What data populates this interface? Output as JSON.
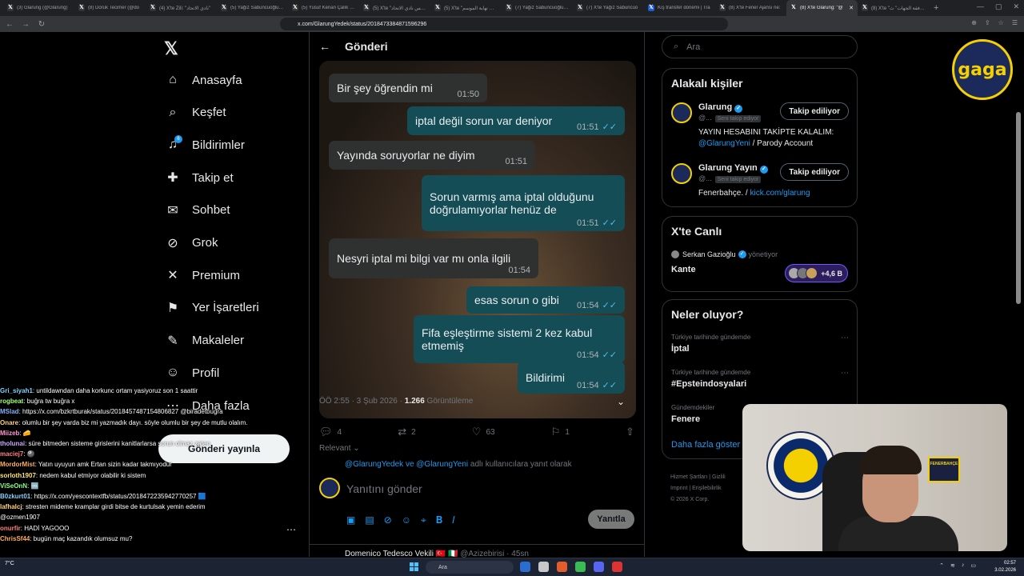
{
  "browser": {
    "tabs": [
      {
        "label": "(3) Glarung (@Glarung)",
        "color": "#333"
      },
      {
        "label": "(8) Doruk Tecimer (@do",
        "color": "#333"
      },
      {
        "label": "(4) X'te Ziİi: \"نادي الاتحاد\"",
        "color": "#333"
      },
      {
        "label": "(5) Yağız Sabuncuoğlu (@",
        "color": "#333"
      },
      {
        "label": "(5) Yusuf Kenan Çalık (@",
        "color": "#333"
      },
      {
        "label": "(5) X'te \"رئيس نادي الاتحاد\"",
        "color": "#333"
      },
      {
        "label": "(5) X'te \"نادي نهاية الموسم\"",
        "color": "#333"
      },
      {
        "label": "(7) Yağız Sabuncuoğlu (@",
        "color": "#333"
      },
      {
        "label": "(7) X'te Yağız Sabuncuo",
        "color": "#333"
      },
      {
        "label": "Kış transfer dönemi | Tra",
        "color": "#1a5ad7"
      },
      {
        "label": "(8) X'te Fener Ajansı ne: ",
        "color": "#333"
      },
      {
        "label": "(8) X'te Glarung: \"@",
        "color": "#333"
      },
      {
        "label": "(8) X'te \"موافقة الجهات\" ث",
        "color": "#333"
      }
    ],
    "active_tab": 11,
    "new_tab": "+",
    "url": "x.com/GlarungYedek/status/2018473384871596296"
  },
  "nav": {
    "items": [
      {
        "label": "Anasayfa",
        "icon": "⌂",
        "name": "home"
      },
      {
        "label": "Keşfet",
        "icon": "⌕",
        "name": "explore"
      },
      {
        "label": "Bildirimler",
        "icon": "♫",
        "name": "notifications",
        "badge": "6"
      },
      {
        "label": "Takip et",
        "icon": "✚",
        "name": "follow"
      },
      {
        "label": "Sohbet",
        "icon": "✉",
        "name": "chat"
      },
      {
        "label": "Grok",
        "icon": "⊘",
        "name": "grok"
      },
      {
        "label": "Premium",
        "icon": "✕",
        "name": "premium"
      },
      {
        "label": "Yer İşaretleri",
        "icon": "⚑",
        "name": "bookmarks"
      },
      {
        "label": "Makaleler",
        "icon": "✎",
        "name": "articles"
      },
      {
        "label": "Profil",
        "icon": "☺",
        "name": "profile"
      },
      {
        "label": "Daha fazla",
        "icon": "⋯",
        "name": "more"
      }
    ],
    "post_button": "Gönderi yayınla"
  },
  "chat": [
    {
      "user": "Gri_siyah1",
      "color": "#7fd3ff",
      "text": ": untildawndan daha korkunc ortam yasiyoruz son 1 saattir"
    },
    {
      "user": "rogbeat",
      "color": "#a0ff7a",
      "text": ": buğra tw buğra x"
    },
    {
      "user": "MSlad",
      "color": "#7fb3ff",
      "text": ": https://x.com/bzkrtburak/status/2018457487154806827 @biradetbugra"
    },
    {
      "user": "Onare",
      "color": "#ffd27f",
      "text": ": olumlu bir şey varda biz mi yazmadık dayı. söyle olumlu bir şey de mutlu olalım."
    },
    {
      "user": "Miizeb",
      "color": "#ff9ad5",
      "text": ": 🧀"
    },
    {
      "user": "tholunai",
      "color": "#c7a8ff",
      "text": ": süre bitmeden sisteme girislerini kanitlarlarsa sorun olmaz zaten"
    },
    {
      "user": "maciej7",
      "color": "#ff7f7f",
      "text": ": 🎱"
    },
    {
      "user": "MordorMist",
      "color": "#ffae5c",
      "text": ": Yatın uyuyun amk Ertan sizin kadar takmıyodur"
    },
    {
      "user": "sorloth1907",
      "color": "#ffe36b",
      "text": ": nedem kabul etmiyor olabilir ki sistem"
    },
    {
      "user": "ViSeOnN",
      "color": "#8aff8a",
      "text": ": 🆒"
    },
    {
      "user": "B0zkurt01",
      "color": "#7fd3ff",
      "text": ": https://x.com/yescontextfb/status/2018472235942770257 🟦"
    },
    {
      "user": "lafhalcj",
      "color": "#ffd27f",
      "text": ": stresten mideme kramplar girdi bitse de kurtulsak yemin ederim"
    },
    {
      "user": "",
      "color": "#fff",
      "text": "@ozmen1907"
    },
    {
      "user": "onurfir",
      "color": "#ff7f7f",
      "text": ": HADİ YAGOOO"
    },
    {
      "user": "ChrisSf44",
      "color": "#ffae5c",
      "text": ": bugün maç kazandık olumsuz mu?"
    }
  ],
  "post": {
    "header_title": "Gönderi",
    "messages": [
      {
        "dir": "in",
        "text": "Bir şey öğrendin mi",
        "time": "01:50",
        "read": ""
      },
      {
        "dir": "out",
        "text": "iptal değil sorun var deniyor",
        "time": "01:51",
        "read": "✓✓"
      },
      {
        "dir": "in",
        "text": "Yayında soruyorlar ne diyim",
        "time": "01:51",
        "read": ""
      },
      {
        "dir": "out",
        "text": "Sorun varmış ama iptal olduğunu doğrulamıyorlar henüz de",
        "time": "01:51",
        "read": "✓✓"
      },
      {
        "dir": "in",
        "text": "Nesyri iptal mi bilgi var mı onla ilgili",
        "time": "01:54",
        "read": ""
      },
      {
        "dir": "out",
        "text": "esas sorun o gibi",
        "time": "01:54",
        "read": "✓✓"
      },
      {
        "dir": "out",
        "text": "Fifa eşleştirme sistemi 2 kez kabul etmemiş",
        "time": "01:54",
        "read": "✓✓"
      },
      {
        "dir": "out",
        "text": "Bildirimi",
        "time": "01:54",
        "read": "✓✓"
      }
    ],
    "timestamp": "ÖÖ 2:55 · 3 Şub 2026 · ",
    "views": "1.266",
    "views_label": " Görüntüleme",
    "replies": "4",
    "reposts": "2",
    "likes": "63",
    "bookmarks": "1",
    "sort_label": "Relevant",
    "reply_to_mentions": "@GlarungYedek ve @GlarungYeni",
    "reply_to_suffix": " adlı kullanıcılara yanıt olarak",
    "compose_placeholder": "Yanıtını gönder",
    "reply_button": "Yanıtla",
    "next_author": "Domenico Tedesco Vekili 🇹🇷 🇮🇹",
    "next_handle": " @Azizebirisi · 45sn"
  },
  "right": {
    "search_placeholder": "Ara",
    "related_title": "Alakalı kişiler",
    "people": [
      {
        "name": "Glarung",
        "handle": "@...",
        "follows_you": "Seni takip ediyor",
        "button": "Takip ediliyor",
        "bio_pre": "YAYIN HESABINI TAKİPTE KALALIM: ",
        "bio_link": "@GlarungYeni",
        "bio_post": " / Parody Account"
      },
      {
        "name": "Glarung Yayın",
        "handle": "@...",
        "follows_you": "Seni takip ediyor",
        "button": "Takip ediliyor",
        "bio_pre": "Fenerbahçe. / ",
        "bio_link": "kick.com/glarung",
        "bio_post": ""
      }
    ],
    "live_title": "X'te Canlı",
    "live_host": "Serkan Gazioğlu",
    "live_role": "yönetiyor",
    "live_space": "Kante",
    "live_count": "+4,6 B",
    "trends_title": "Neler oluyor?",
    "trends": [
      {
        "context": "Türkiye tarihinde gündemde",
        "topic": "İptal"
      },
      {
        "context": "Türkiye tarihinde gündemde",
        "topic": "#Epsteindosyalari"
      },
      {
        "context": "Gündemdekiler",
        "topic": "Fenere"
      }
    ],
    "show_more": "Daha fazla göster",
    "footer": [
      "Hizmet Şartları",
      "Gizlili",
      "Imprint",
      "Erişilebilirlik",
      "© 2026 X Corp."
    ]
  },
  "overlay": {
    "logo_text": "gaga",
    "poster_text": "FENERBAHÇE"
  },
  "taskbar": {
    "weather": "7°C",
    "search_placeholder": "Ara",
    "time": "02:57",
    "date": "3.02.2026"
  }
}
